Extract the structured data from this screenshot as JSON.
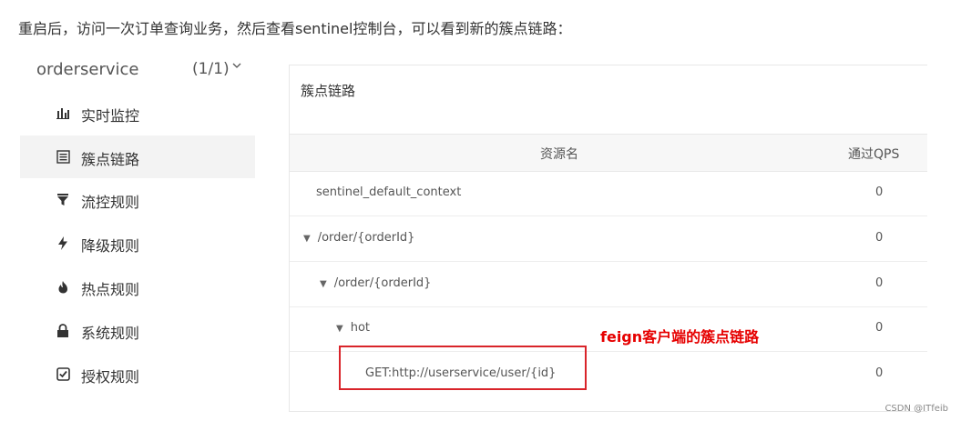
{
  "intro_text": "重启后，访问一次订单查询业务，然后查看sentinel控制台，可以看到新的簇点链路：",
  "sidebar": {
    "app_name": "orderservice",
    "app_count": "(1/1)",
    "items": [
      {
        "label": "实时监控",
        "icon": "bar-chart-icon"
      },
      {
        "label": "簇点链路",
        "icon": "list-icon"
      },
      {
        "label": "流控规则",
        "icon": "filter-icon"
      },
      {
        "label": "降级规则",
        "icon": "lightning-icon"
      },
      {
        "label": "热点规则",
        "icon": "fire-icon"
      },
      {
        "label": "系统规则",
        "icon": "lock-icon"
      },
      {
        "label": "授权规则",
        "icon": "check-square-icon"
      }
    ]
  },
  "panel": {
    "title": "簇点链路",
    "columns": {
      "resource": "资源名",
      "qps": "通过QPS"
    },
    "rows": [
      {
        "name": "sentinel_default_context",
        "qps": "0"
      },
      {
        "name": "/order/{orderId}",
        "qps": "0"
      },
      {
        "name": "/order/{orderId}",
        "qps": "0"
      },
      {
        "name": "hot",
        "qps": "0"
      },
      {
        "name": "GET:http://userservice/user/{id}",
        "qps": "0"
      }
    ]
  },
  "annotation": "feign客户端的簇点链路",
  "watermark": "CSDN @ITfeib",
  "colors": {
    "annotation": "#e60000",
    "active_bg": "#f3f3f3"
  }
}
